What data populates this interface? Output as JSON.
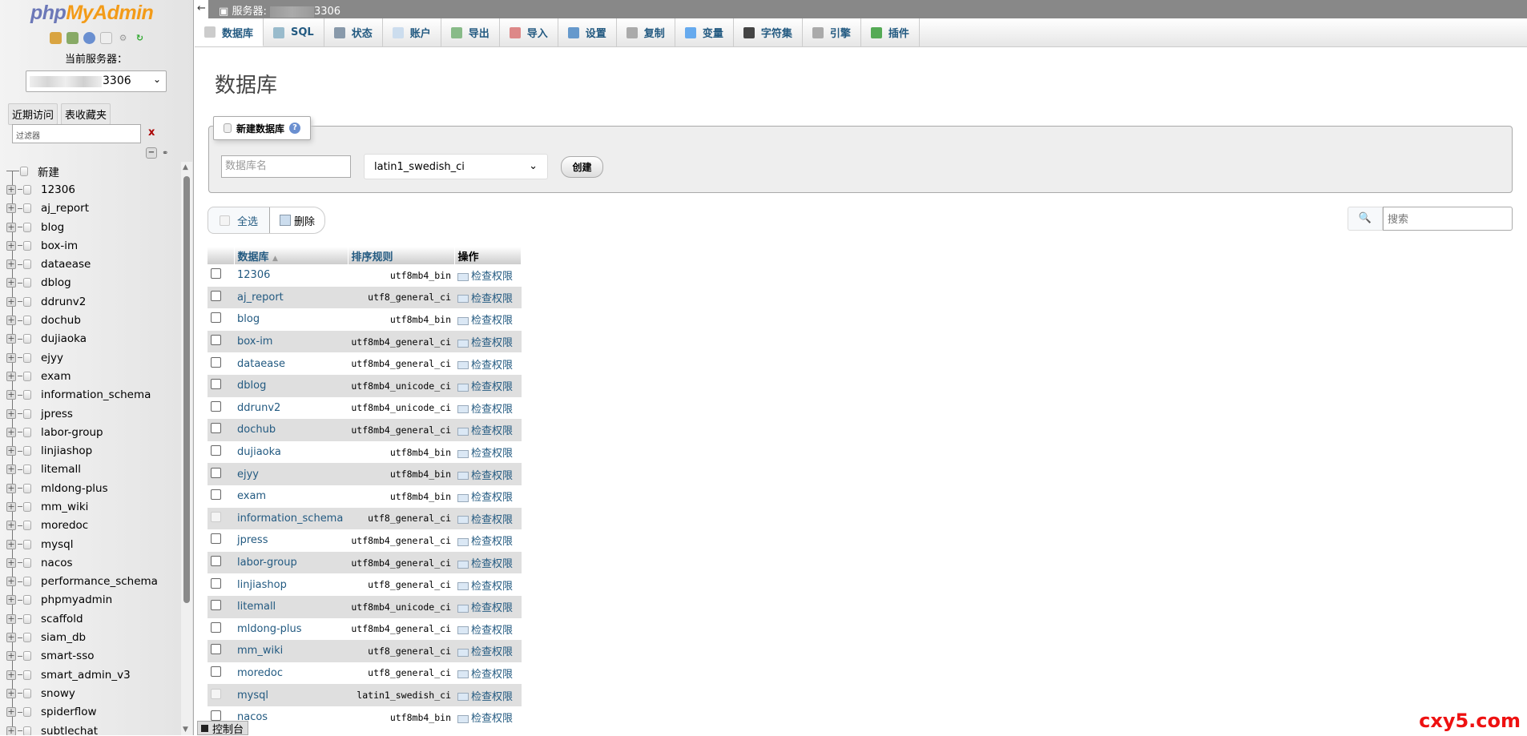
{
  "sidebar": {
    "logo_php": "php",
    "logo_my": "MyAdmin",
    "current_server_label": "当前服务器：",
    "server_value": "3306",
    "tabs": [
      "近期访问",
      "表收藏夹"
    ],
    "filter_placeholder": "过滤器",
    "filter_clear": "x",
    "tree_new": "新建",
    "databases": [
      "12306",
      "aj_report",
      "blog",
      "box-im",
      "dataease",
      "dblog",
      "ddrunv2",
      "dochub",
      "dujiaoka",
      "ejyy",
      "exam",
      "information_schema",
      "jpress",
      "labor-group",
      "linjiashop",
      "litemall",
      "mldong-plus",
      "mm_wiki",
      "moredoc",
      "mysql",
      "nacos",
      "performance_schema",
      "phpmyadmin",
      "scaffold",
      "siam_db",
      "smart-sso",
      "smart_admin_v3",
      "snowy",
      "spiderflow",
      "subtlechat"
    ]
  },
  "topbar": {
    "back": "←",
    "server_label": "服务器:",
    "server_port": "3306"
  },
  "tabs": [
    {
      "label": "数据库",
      "icon": "database-icon"
    },
    {
      "label": "SQL",
      "icon": "sql-icon"
    },
    {
      "label": "状态",
      "icon": "status-icon"
    },
    {
      "label": "账户",
      "icon": "accounts-icon"
    },
    {
      "label": "导出",
      "icon": "export-icon"
    },
    {
      "label": "导入",
      "icon": "import-icon"
    },
    {
      "label": "设置",
      "icon": "settings-icon"
    },
    {
      "label": "复制",
      "icon": "replication-icon"
    },
    {
      "label": "变量",
      "icon": "variables-icon"
    },
    {
      "label": "字符集",
      "icon": "charset-icon"
    },
    {
      "label": "引擎",
      "icon": "engine-icon"
    },
    {
      "label": "插件",
      "icon": "plugin-icon"
    }
  ],
  "main": {
    "title": "数据库",
    "create_legend": "新建数据库",
    "dbname_placeholder": "数据库名",
    "collation": "latin1_swedish_ci",
    "create_button": "创建",
    "select_all": "全选",
    "delete": "删除",
    "search_placeholder": "搜索",
    "columns": [
      "数据库",
      "排序规则",
      "操作"
    ],
    "check_privileges": "检查权限",
    "rows": [
      {
        "name": "12306",
        "collation": "utf8mb4_bin"
      },
      {
        "name": "aj_report",
        "collation": "utf8_general_ci"
      },
      {
        "name": "blog",
        "collation": "utf8mb4_bin"
      },
      {
        "name": "box-im",
        "collation": "utf8mb4_general_ci"
      },
      {
        "name": "dataease",
        "collation": "utf8mb4_general_ci"
      },
      {
        "name": "dblog",
        "collation": "utf8mb4_unicode_ci"
      },
      {
        "name": "ddrunv2",
        "collation": "utf8mb4_unicode_ci"
      },
      {
        "name": "dochub",
        "collation": "utf8mb4_general_ci"
      },
      {
        "name": "dujiaoka",
        "collation": "utf8mb4_bin"
      },
      {
        "name": "ejyy",
        "collation": "utf8mb4_bin"
      },
      {
        "name": "exam",
        "collation": "utf8mb4_bin"
      },
      {
        "name": "information_schema",
        "collation": "utf8_general_ci",
        "disabled": true
      },
      {
        "name": "jpress",
        "collation": "utf8mb4_general_ci"
      },
      {
        "name": "labor-group",
        "collation": "utf8mb4_general_ci"
      },
      {
        "name": "linjiashop",
        "collation": "utf8_general_ci"
      },
      {
        "name": "litemall",
        "collation": "utf8mb4_unicode_ci"
      },
      {
        "name": "mldong-plus",
        "collation": "utf8mb4_general_ci"
      },
      {
        "name": "mm_wiki",
        "collation": "utf8_general_ci"
      },
      {
        "name": "moredoc",
        "collation": "utf8_general_ci"
      },
      {
        "name": "mysql",
        "collation": "latin1_swedish_ci",
        "disabled": true
      },
      {
        "name": "nacos",
        "collation": "utf8mb4_bin"
      }
    ]
  },
  "console": "控制台",
  "watermark": "cxy5.com"
}
